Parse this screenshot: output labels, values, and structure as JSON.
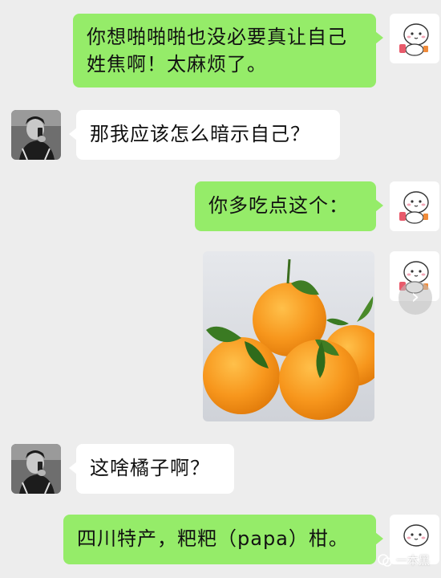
{
  "messages": [
    {
      "side": "sent",
      "text": "你想啪啪啪也没必要真让自己姓焦啊！太麻烦了。"
    },
    {
      "side": "received",
      "text": "那我应该怎么暗示自己？"
    },
    {
      "side": "sent",
      "text": "你多吃点这个："
    },
    {
      "side": "sent",
      "type": "image",
      "subject": "oranges"
    },
    {
      "side": "received",
      "text": "这啥橘子啊？"
    },
    {
      "side": "sent",
      "text": "四川特产，粑粑（papa）柑。"
    }
  ],
  "msg1": {
    "line1": "你想啪啪啪也没必要真让自己",
    "line2": "姓焦啊！太麻烦了。"
  },
  "msg2": {
    "text": "那我应该怎么暗示自己？"
  },
  "msg3": {
    "text": "你多吃点这个："
  },
  "msg5": {
    "text": "这啥橘子啊？"
  },
  "msg6": {
    "text": "四川特产，粑粑（papa）柑。"
  },
  "watermark": {
    "text": "一本黑"
  },
  "icons": {
    "self_avatar": "cartoon-bun-avatar",
    "other_avatar": "person-on-phone-photo",
    "image_nav": "chevron-right-icon",
    "watermark": "wechat-official-account-icon"
  },
  "colors": {
    "background": "#ededed",
    "sent_bubble": "#95ec69",
    "received_bubble": "#ffffff"
  }
}
